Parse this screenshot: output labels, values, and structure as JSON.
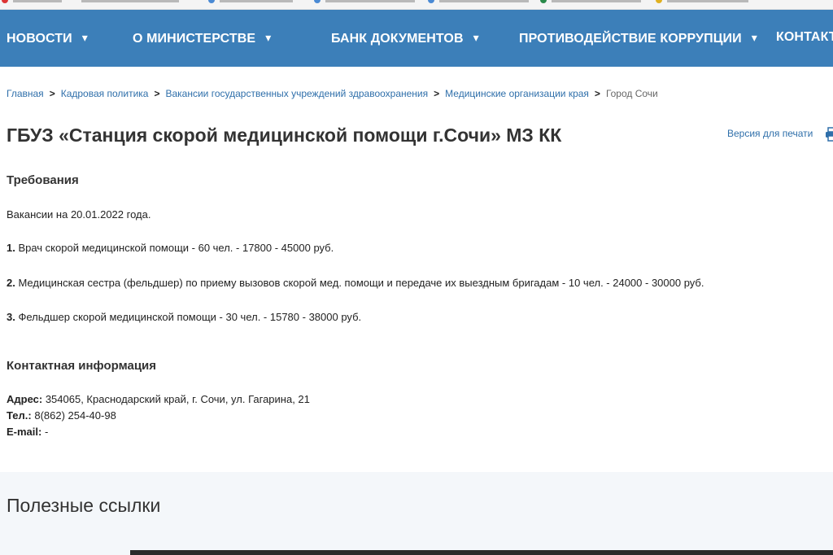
{
  "nav": {
    "items": [
      {
        "label": "НОВОСТИ"
      },
      {
        "label": "О МИНИСТЕРСТВЕ"
      },
      {
        "label": "БАНК ДОКУМЕНТОВ"
      },
      {
        "label": "ПРОТИВОДЕЙСТВИЕ КОРРУПЦИИ"
      },
      {
        "label": "КОНТАКТ"
      }
    ],
    "chevron": "▾"
  },
  "breadcrumb": {
    "separator": ">",
    "items": [
      {
        "label": "Главная"
      },
      {
        "label": "Кадровая политика"
      },
      {
        "label": "Вакансии государственных учреждений здравоохранения"
      },
      {
        "label": "Медицинские организации края"
      }
    ],
    "current": "Город Сочи"
  },
  "page": {
    "title": "ГБУЗ «Станция скорой медицинской помощи г.Сочи» МЗ КК",
    "print_label": "Версия для печати",
    "print_icon": "printer-icon"
  },
  "requirements": {
    "heading": "Требования",
    "date_line": "Вакансии на 20.01.2022 года.",
    "vacancies": [
      {
        "num": "1.",
        "text": " Врач скорой медицинской помощи - 60 чел. - 17800 - 45000 руб."
      },
      {
        "num": "2.",
        "text": " Медицинская сестра (фельдшер) по приему вызовов скорой мед. помощи и передаче их выездным бригадам - 10 чел. - 24000 - 30000 руб."
      },
      {
        "num": "3.",
        "text": " Фельдшер скорой медицинской помощи - 30 чел. - 15780 - 38000 руб."
      }
    ]
  },
  "contacts": {
    "heading": "Контактная информация",
    "address_label": "Адрес:",
    "address_value": " 354065, Краснодарский край, г. Сочи, ул. Гагарина, 21",
    "phone_label": "Тел.:",
    "phone_value": " 8(862) 254-40-98",
    "email_label": "E-mail:",
    "email_value": " -"
  },
  "useful_links": {
    "heading": "Полезные ссылки"
  },
  "colors": {
    "nav_bg": "#3c7fb9",
    "link": "#2f6faa"
  }
}
